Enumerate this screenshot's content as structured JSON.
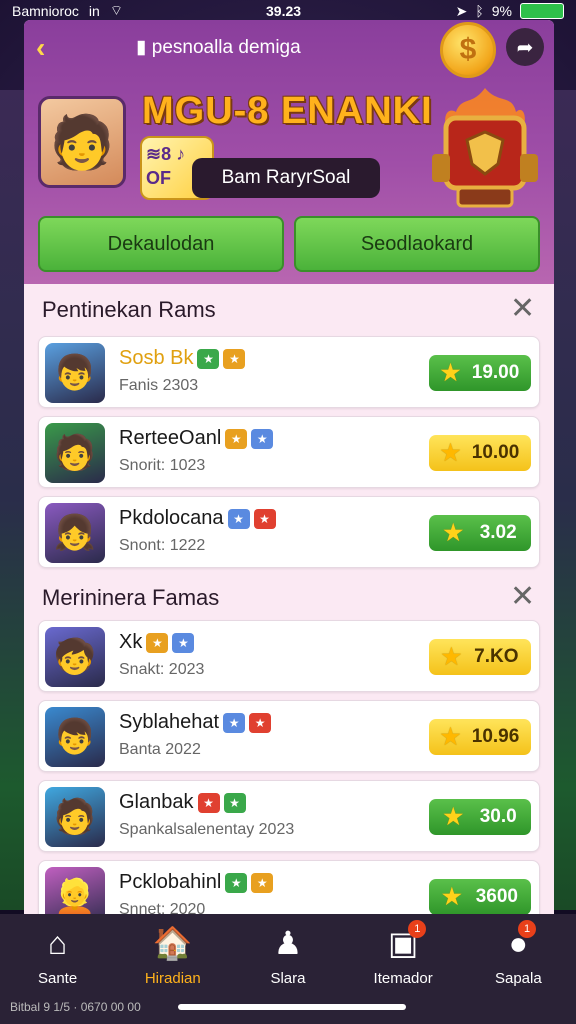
{
  "status_bar": {
    "carrier": "Bamnioroc",
    "network": "in",
    "time": "39.23",
    "battery": "9%"
  },
  "header": {
    "title": "pesnoalla demiga",
    "game_title": "MGU-8 ENANKI",
    "logo_text": "≋8 ♪ OF",
    "rank_label": "Bam RaryrSoal",
    "coin_symbol": "$",
    "buttons": [
      "Dekaulodan",
      "Seodlaokard"
    ]
  },
  "sections": [
    {
      "title": "Pentinekan Rams",
      "items": [
        {
          "name": "Sosb Bk",
          "sub": "Fanis 2303",
          "score": "19.00",
          "style": "green",
          "name_color": "#e0a010",
          "thumb_bg": "#5aa0e0",
          "avatar": "👦"
        },
        {
          "name": "RerteeOanl",
          "sub": "Snorit: 1023",
          "score": "10.00",
          "style": "yellow",
          "name_color": "#1a1a1a",
          "thumb_bg": "#3a9a4a",
          "avatar": "🧑"
        },
        {
          "name": "Pkdolocana",
          "sub": "Snont: 1222",
          "score": "3.02",
          "style": "green",
          "name_color": "#1a1a1a",
          "thumb_bg": "#8a5ac0",
          "avatar": "👧"
        }
      ]
    },
    {
      "title": "Merininera Famas",
      "items": [
        {
          "name": "Xk",
          "sub": "Snakt: 2023",
          "score": "7.KO",
          "style": "yellow",
          "name_color": "#1a1a1a",
          "thumb_bg": "#6a6ad0",
          "avatar": "🧒"
        },
        {
          "name": "Syblahehat",
          "sub": "Banta 2022",
          "score": "10.96",
          "style": "yellow",
          "name_color": "#1a1a1a",
          "thumb_bg": "#3a8ad0",
          "avatar": "👦"
        },
        {
          "name": "Glanbak",
          "sub": "Spankalsalenentay 2023",
          "score": "30.0",
          "style": "green",
          "name_color": "#1a1a1a",
          "thumb_bg": "#40a8e0",
          "avatar": "🧑"
        },
        {
          "name": "Pcklobahinl",
          "sub": "Snnet: 2020",
          "score": "3600",
          "style": "green",
          "name_color": "#1a1a1a",
          "thumb_bg": "#c060c0",
          "avatar": "👱"
        }
      ]
    }
  ],
  "tabs": [
    {
      "label": "Sante",
      "icon": "home-icon",
      "glyph": "⌂",
      "active": false
    },
    {
      "label": "Hiradian",
      "icon": "house-icon",
      "glyph": "🏠",
      "active": true
    },
    {
      "label": "Slara",
      "icon": "player-icon",
      "glyph": "♟",
      "active": false
    },
    {
      "label": "Itemador",
      "icon": "item-box-icon",
      "glyph": "▣",
      "active": false,
      "badge": "1"
    },
    {
      "label": "Sapala",
      "icon": "gear-character-icon",
      "glyph": "●",
      "active": false,
      "badge": "1"
    }
  ],
  "footer": "Bitbal 9 1/5 · 0670 00 00",
  "colors": {
    "header_purple": "#a04fa8",
    "button_green": "#4bb23a",
    "score_yellow": "#f4c21a",
    "title_orange": "#ffb21c"
  }
}
